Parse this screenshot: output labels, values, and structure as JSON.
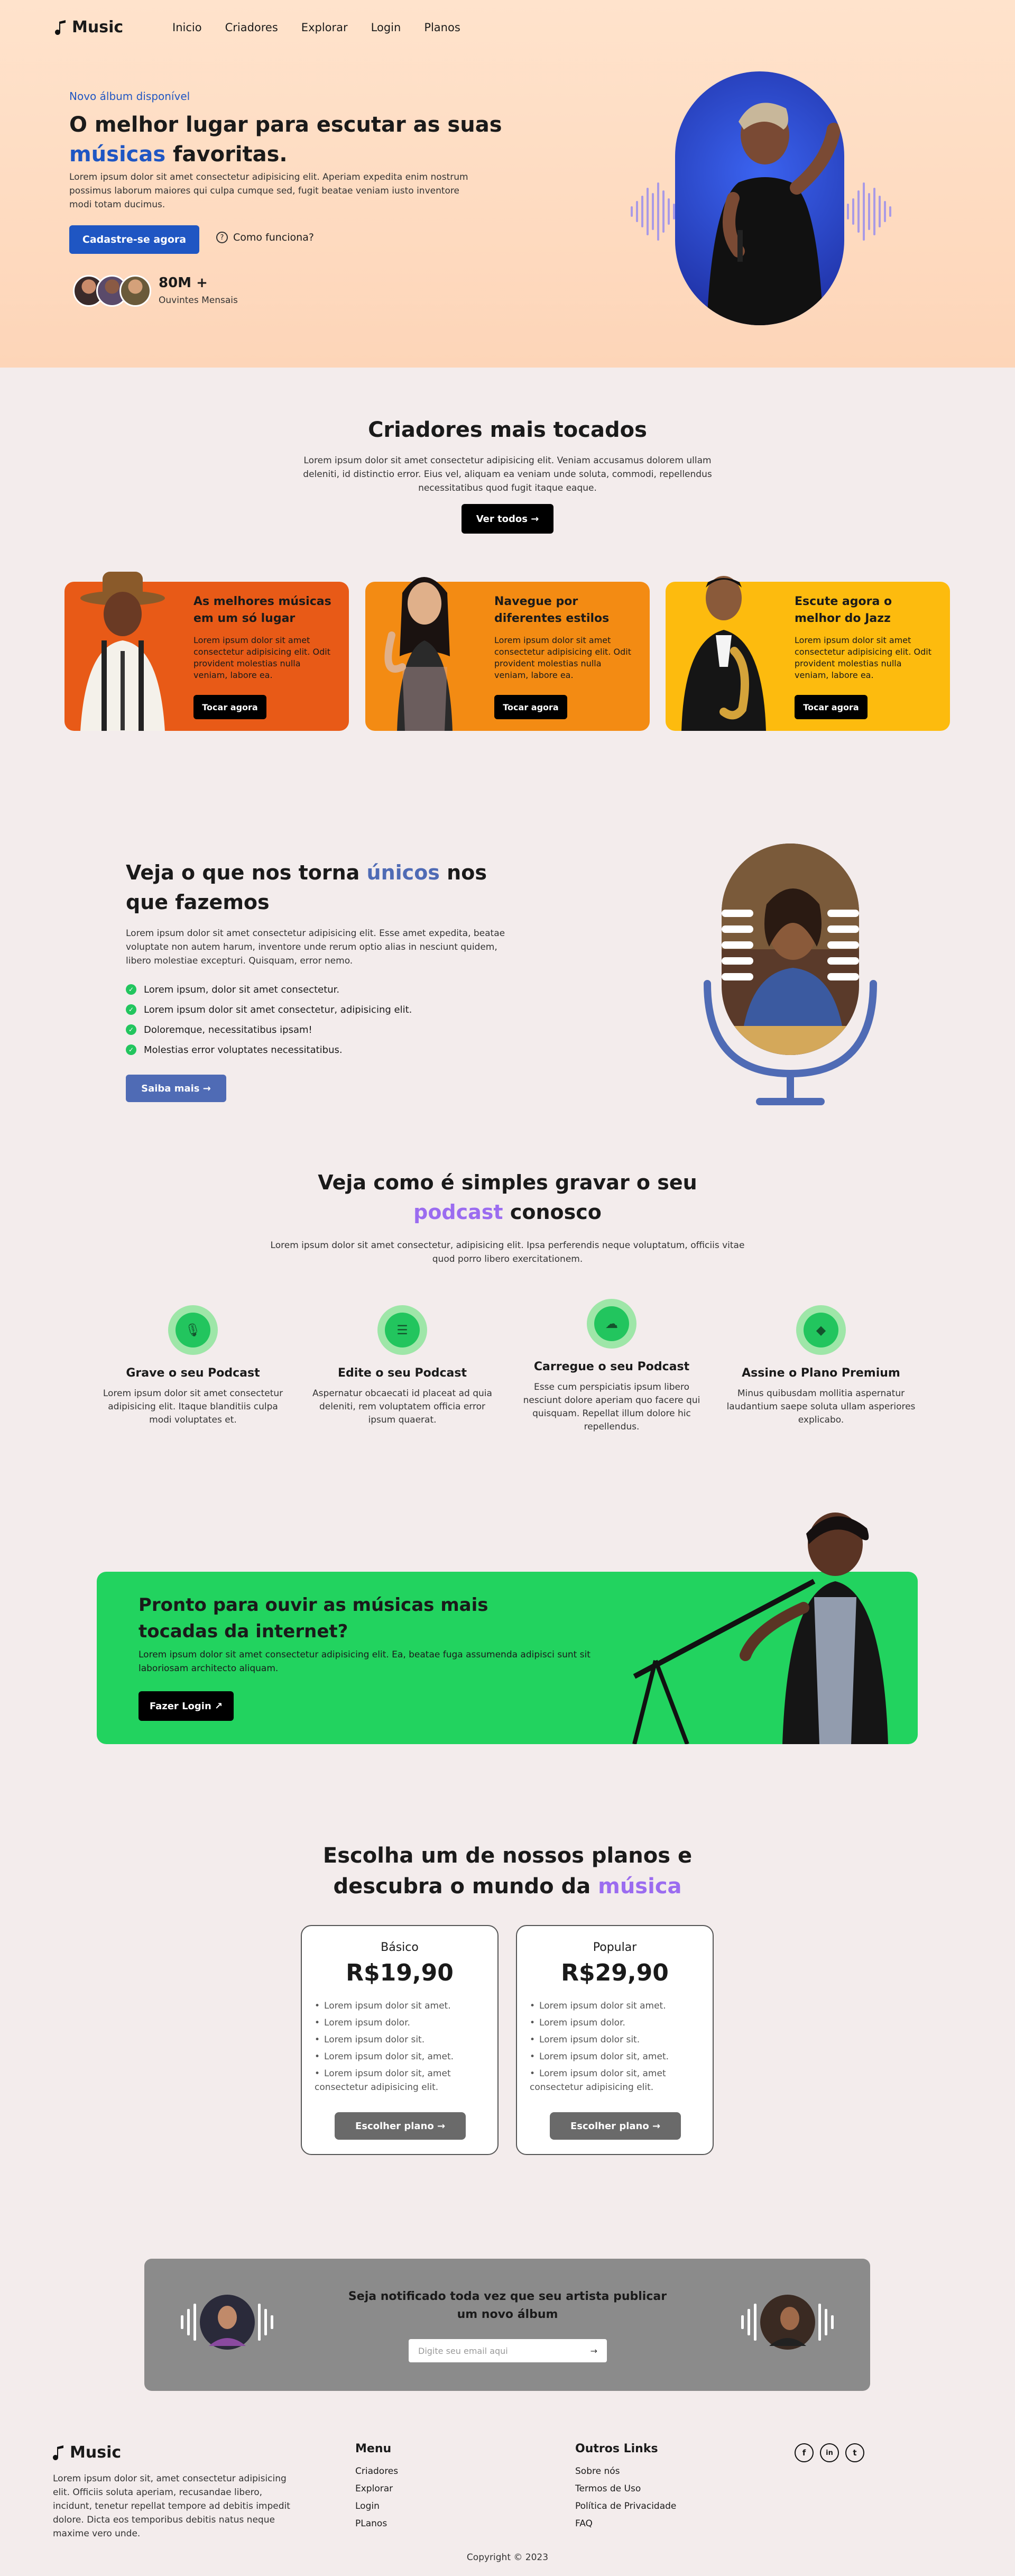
{
  "nav": {
    "logo": "Music",
    "links": [
      "Inicio",
      "Criadores",
      "Explorar",
      "Login",
      "Planos"
    ]
  },
  "hero": {
    "eyebrow": "Novo álbum disponível",
    "title_part1": "O melhor lugar para escutar as suas",
    "title_highlight": "músicas",
    "title_part2": "favoritas.",
    "description": "Lorem ipsum dolor sit amet consectetur adipisicing elit. Aperiam expedita enim nostrum possimus laborum maiores qui culpa cumque sed, fugit beatae veniam iusto inventore modi totam ducimus.",
    "cta_primary": "Cadastre-se agora",
    "cta_secondary": "Como funciona?",
    "stat_value": "80M +",
    "stat_label": "Ouvintes Mensais"
  },
  "creators": {
    "title": "Criadores mais tocados",
    "description": "Lorem ipsum dolor sit amet consectetur adipisicing elit. Veniam accusamus dolorem ullam deleniti, id distinctio error. Eius vel, aliquam ea veniam unde soluta, commodi, repellendus necessitatibus quod fugit itaque eaque.",
    "button": "Ver todos →",
    "cards": [
      {
        "title": "As melhores músicas em um só lugar",
        "text": "Lorem ipsum dolor sit amet consectetur adipisicing elit. Odit provident molestias nulla veniam, labore ea.",
        "button": "Tocar agora",
        "color": "#e85a17"
      },
      {
        "title": "Navegue por diferentes estilos",
        "text": "Lorem ipsum dolor sit amet consectetur adipisicing elit. Odit provident molestias nulla veniam, labore ea.",
        "button": "Tocar agora",
        "color": "#f38b13"
      },
      {
        "title": "Escute agora o melhor do Jazz",
        "text": "Lorem ipsum dolor sit amet consectetur adipisicing elit. Odit provident molestias nulla veniam, labore ea.",
        "button": "Tocar agora",
        "color": "#fdbb0e"
      }
    ]
  },
  "unique": {
    "title_part1": "Veja o que nos torna",
    "title_highlight": "únicos",
    "title_part2": "nos que fazemos",
    "description": "Lorem ipsum dolor sit amet consectetur adipisicing elit. Esse amet expedita, beatae voluptate non autem harum, inventore unde rerum optio alias in nesciunt quidem, libero molestiae excepturi. Quisquam, error nemo.",
    "features": [
      "Lorem ipsum, dolor sit amet consectetur.",
      "Lorem ipsum dolor sit amet consectetur, adipisicing elit.",
      "Doloremque, necessitatibus ipsam!",
      "Molestias error voluptates necessitatibus."
    ],
    "button": "Saiba mais →"
  },
  "podcast": {
    "title_part1": "Veja como é simples gravar o seu",
    "title_highlight": "podcast",
    "title_part2": "conosco",
    "description": "Lorem ipsum dolor sit amet consectetur, adipisicing elit. Ipsa perferendis neque voluptatum, officiis vitae quod porro libero exercitationem.",
    "steps": [
      {
        "icon": "microphone-icon",
        "title": "Grave o seu Podcast",
        "text": "Lorem ipsum dolor sit amet consectetur adipisicing elit. Itaque blanditiis culpa modi voluptates et."
      },
      {
        "icon": "sliders-icon",
        "title": "Edite o seu Podcast",
        "text": "Aspernatur obcaecati id placeat ad quia deleniti, rem voluptatem officia error ipsum quaerat."
      },
      {
        "icon": "cloud-upload-icon",
        "title": "Carregue o seu Podcast",
        "text": "Esse cum perspiciatis ipsum libero nesciunt dolore aperiam quo facere qui quisquam. Repellat illum dolore hic repellendus."
      },
      {
        "icon": "diamond-icon",
        "title": "Assine o Plano Premium",
        "text": "Minus quibusdam mollitia aspernatur laudantium saepe soluta ullam asperiores explicabo."
      }
    ]
  },
  "cta": {
    "title": "Pronto para ouvir as músicas mais tocadas da internet?",
    "description": "Lorem ipsum dolor sit amet consectetur adipisicing elit. Ea, beatae fuga assumenda adipisci sunt sit laboriosam architecto aliquam.",
    "button": "Fazer Login ↗"
  },
  "plans": {
    "title_part1": "Escolha um de nossos planos e descubra o mundo da",
    "title_highlight": "música",
    "items": [
      {
        "name": "Básico",
        "price": "R$19,90",
        "features": [
          "Lorem ipsum dolor sit amet.",
          "Lorem ipsum dolor.",
          "Lorem ipsum dolor sit.",
          "Lorem ipsum dolor sit, amet.",
          "Lorem ipsum dolor sit, amet consectetur adipisicing elit."
        ],
        "button": "Escolher plano →"
      },
      {
        "name": "Popular",
        "price": "R$29,90",
        "features": [
          "Lorem ipsum dolor sit amet.",
          "Lorem ipsum dolor.",
          "Lorem ipsum dolor sit.",
          "Lorem ipsum dolor sit, amet.",
          "Lorem ipsum dolor sit, amet consectetur adipisicing elit."
        ],
        "button": "Escolher plano →"
      }
    ]
  },
  "newsletter": {
    "title": "Seja notificado toda vez que seu artista publicar um novo álbum",
    "placeholder": "Digite seu email aqui",
    "submit": "→"
  },
  "footer": {
    "logo": "Music",
    "description": "Lorem ipsum dolor sit, amet consectetur adipisicing elit. Officiis soluta aperiam, recusandae libero, incidunt, tenetur repellat tempore ad debitis impedit dolore. Dicta eos temporibus debitis natus neque maxime vero unde.",
    "menu_title": "Menu",
    "menu": [
      "Criadores",
      "Explorar",
      "Login",
      "PLanos"
    ],
    "links_title": "Outros Links",
    "links": [
      "Sobre nós",
      "Termos de Uso",
      "Política de Privacidade",
      "FAQ"
    ],
    "social": [
      "f",
      "in",
      "t"
    ],
    "copyright": "Copyright © 2023"
  },
  "colors": {
    "accent_blue": "#1f56c3",
    "accent_purple": "#9b6cf0",
    "green": "#22c55e",
    "slate_blue": "#4f6bb5"
  }
}
